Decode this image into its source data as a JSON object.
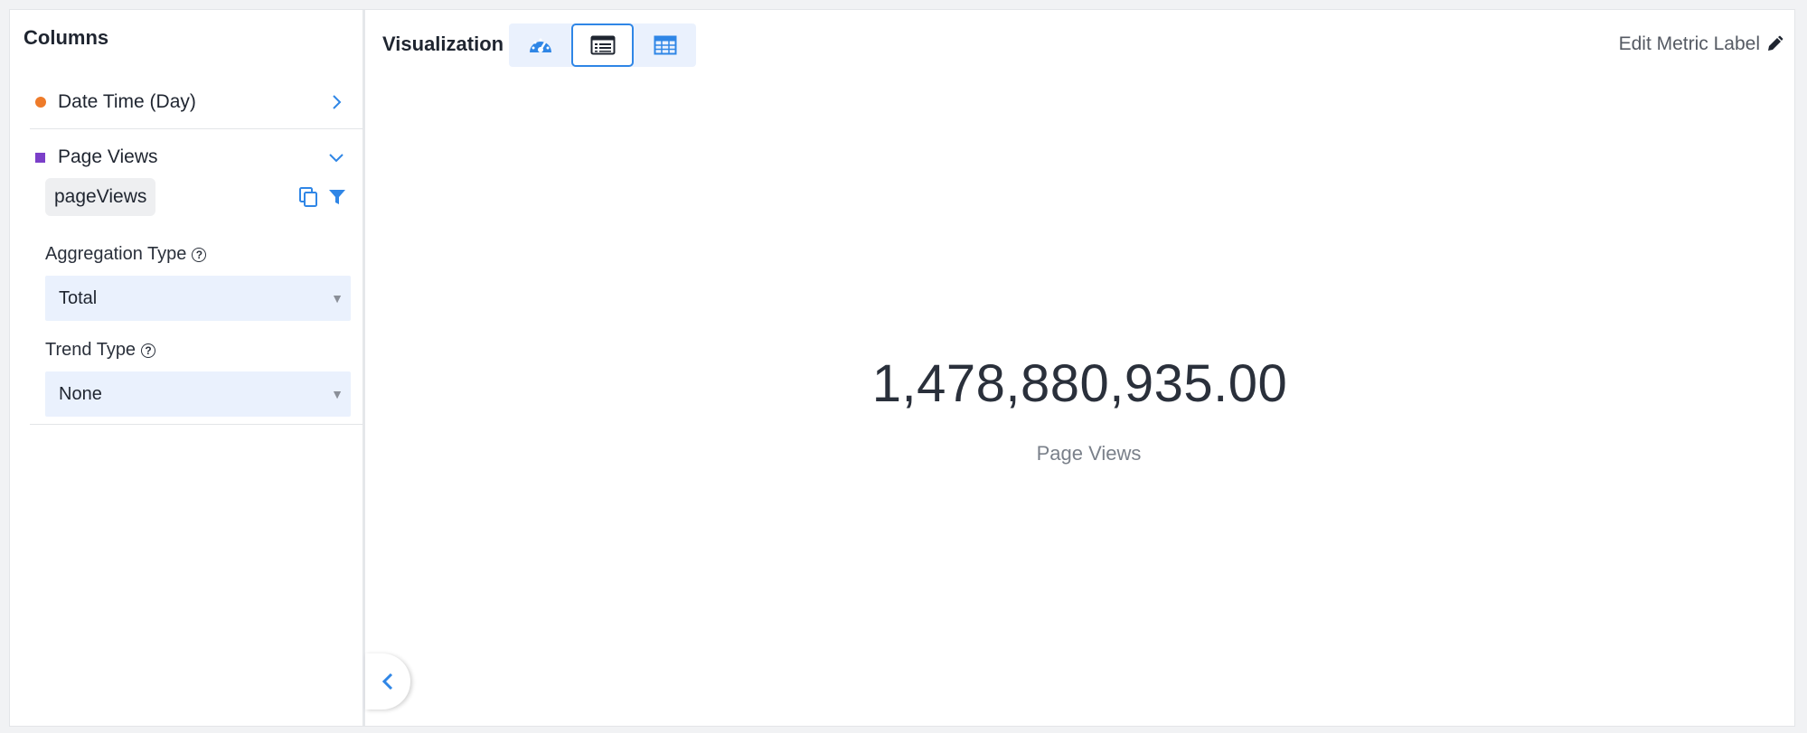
{
  "sidebar": {
    "title": "Columns",
    "columns": [
      {
        "label": "Date Time (Day)",
        "marker_color": "#ee7b2a",
        "expanded": false
      },
      {
        "label": "Page Views",
        "marker_color": "#7b3fc9",
        "expanded": true
      }
    ],
    "field_chip": "pageViews",
    "aggregation_label": "Aggregation Type",
    "aggregation_value": "Total",
    "trend_label": "Trend Type",
    "trend_value": "None"
  },
  "main": {
    "visualization_label": "Visualization",
    "vis_options": [
      {
        "icon": "gauge-icon",
        "active": false
      },
      {
        "icon": "list-icon",
        "active": true
      },
      {
        "icon": "table-icon",
        "active": false
      }
    ],
    "edit_metric_label": "Edit Metric Label",
    "metric_value": "1,478,880,935.00",
    "metric_caption": "Page Views"
  },
  "colors": {
    "accent": "#2f86e6",
    "select_bg": "#eaf1fd"
  }
}
